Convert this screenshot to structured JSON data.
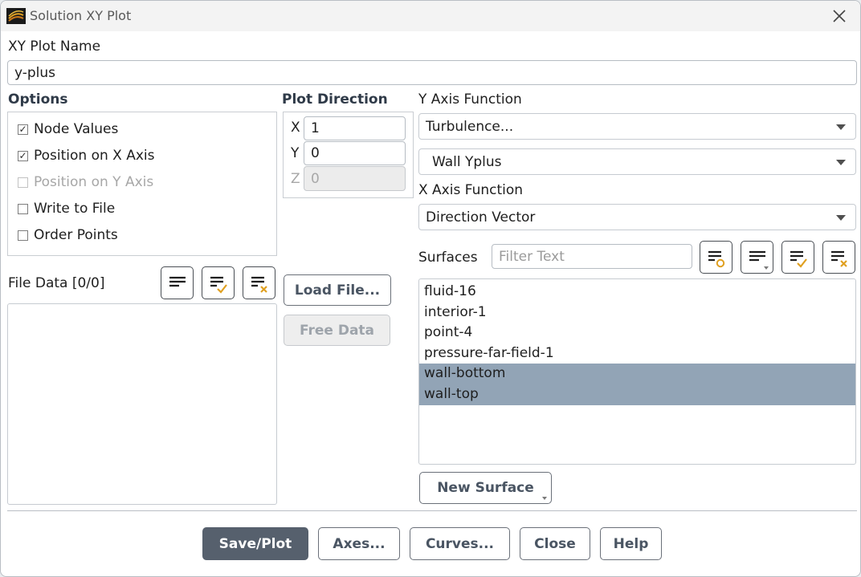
{
  "window": {
    "title": "Solution XY Plot"
  },
  "plot_name": {
    "label": "XY Plot Name",
    "value": "y-plus"
  },
  "options": {
    "label": "Options",
    "items": [
      {
        "label": "Node Values",
        "checked": true,
        "enabled": true
      },
      {
        "label": "Position on X Axis",
        "checked": true,
        "enabled": true
      },
      {
        "label": "Position on Y Axis",
        "checked": false,
        "enabled": false
      },
      {
        "label": "Write to File",
        "checked": false,
        "enabled": true
      },
      {
        "label": "Order Points",
        "checked": false,
        "enabled": true
      }
    ]
  },
  "plot_direction": {
    "label": "Plot Direction",
    "x": {
      "label": "X",
      "value": "1"
    },
    "y": {
      "label": "Y",
      "value": "0"
    },
    "z": {
      "label": "Z",
      "value": "0"
    }
  },
  "y_axis_function": {
    "label": "Y Axis Function",
    "category": "Turbulence...",
    "function": "Wall Yplus"
  },
  "x_axis_function": {
    "label": "X Axis Function",
    "value": "Direction Vector"
  },
  "surfaces": {
    "label": "Surfaces",
    "filter_placeholder": "Filter Text",
    "items": [
      {
        "label": "fluid-16",
        "selected": false
      },
      {
        "label": "interior-1",
        "selected": false
      },
      {
        "label": "point-4",
        "selected": false
      },
      {
        "label": "pressure-far-field-1",
        "selected": false
      },
      {
        "label": "wall-bottom",
        "selected": true
      },
      {
        "label": "wall-top",
        "selected": true
      }
    ],
    "new_surface_label": "New Surface"
  },
  "file_data": {
    "label": "File Data [0/0]",
    "load_file_label": "Load File...",
    "free_data_label": "Free Data"
  },
  "footer": {
    "save_plot_label": "Save/Plot",
    "axes_label": "Axes...",
    "curves_label": "Curves...",
    "close_label": "Close",
    "help_label": "Help"
  },
  "colors": {
    "selection": "#92a4b6",
    "primary_button": "#56606d",
    "heading": "#2f3a48"
  }
}
